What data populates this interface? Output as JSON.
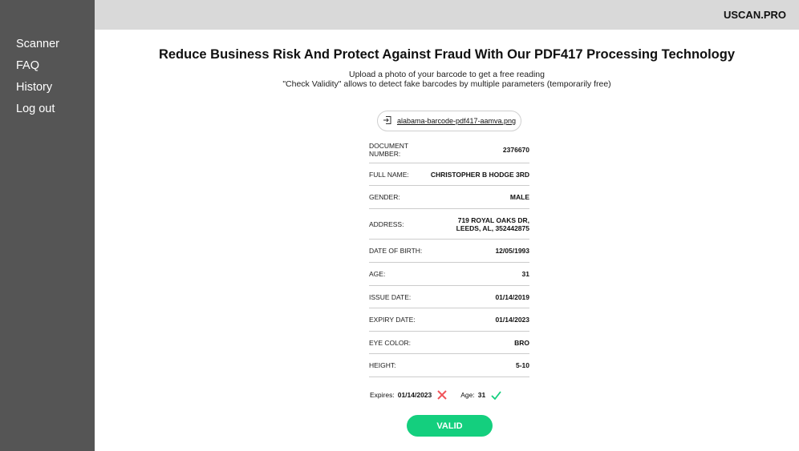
{
  "sidebar": {
    "items": [
      {
        "label": "Scanner"
      },
      {
        "label": "FAQ"
      },
      {
        "label": "History"
      },
      {
        "label": "Log out"
      }
    ]
  },
  "header": {
    "brand": "USCAN.PRO"
  },
  "main": {
    "title": "Reduce Business Risk And Protect Against Fraud With Our PDF417 Processing Technology",
    "subtitle_line1": "Upload a photo of your barcode to get a free reading",
    "subtitle_line2": "\"Check Validity\" allows to detect fake barcodes by multiple parameters (temporarily free)",
    "file": {
      "icon": "file-import-icon",
      "name": "alabama-barcode-pdf417-aamva.png"
    },
    "fields": [
      {
        "label": "DOCUMENT NUMBER:",
        "value": "2376670"
      },
      {
        "label": "FULL NAME:",
        "value": "CHRISTOPHER B HODGE 3RD"
      },
      {
        "label": "GENDER:",
        "value": "MALE"
      },
      {
        "label": "ADDRESS:",
        "value": "719 ROYAL OAKS DR, LEEDS, AL, 352442875"
      },
      {
        "label": "DATE OF BIRTH:",
        "value": "12/05/1993"
      },
      {
        "label": "AGE:",
        "value": "31"
      },
      {
        "label": "ISSUE DATE:",
        "value": "01/14/2019"
      },
      {
        "label": "EXPIRY DATE:",
        "value": "01/14/2023"
      },
      {
        "label": "EYE COLOR:",
        "value": "BRO"
      },
      {
        "label": "HEIGHT:",
        "value": "5-10"
      }
    ],
    "checks": {
      "expires_label": "Expires:",
      "expires_value": "01/14/2023",
      "expires_status": "fail",
      "age_label": "Age:",
      "age_value": "31",
      "age_status": "pass"
    },
    "valid_button": "VALID",
    "colors": {
      "valid": "#14cf7e",
      "fail": "#f0555b",
      "pass": "#14cf7e"
    }
  }
}
